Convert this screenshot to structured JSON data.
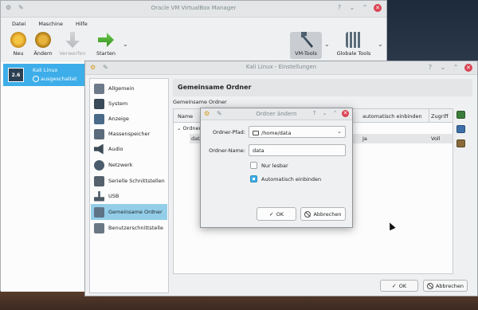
{
  "main": {
    "title": "Oracle VM VirtualBox Manager",
    "menu": [
      "Datei",
      "Maschine",
      "Hilfe"
    ],
    "toolbar": {
      "new_label": "Neu",
      "change_label": "Ändern",
      "discard_label": "Verwerfen",
      "start_label": "Starten",
      "vm_tools_label": "VM-Tools",
      "global_tools_label": "Globale Tools"
    },
    "vm": {
      "name": "Kali Linux",
      "state": "ausgeschaltet",
      "os_badge": "2.6"
    }
  },
  "settings": {
    "title": "Kali Linux - Einstellungen",
    "nav": [
      "Allgemein",
      "System",
      "Anzeige",
      "Massenspeicher",
      "Audio",
      "Netzwerk",
      "Serielle Schnittstellen",
      "USB",
      "Gemeinsame Ordner",
      "Benutzerschnittstelle"
    ],
    "selected_nav": "Gemeinsame Ordner",
    "page_title": "Gemeinsame Ordner",
    "section_label": "Gemeinsame Ordner",
    "table": {
      "columns": [
        "Name",
        "automatisch einbinden",
        "Zugriff"
      ],
      "group": "Ordner",
      "row": {
        "name": "data",
        "auto": "Ja",
        "access": "Voll"
      }
    },
    "ok_label": "OK",
    "cancel_label": "Abbrechen"
  },
  "dialog": {
    "title": "Ordner ändern",
    "path_label": "Ordner-Pfad:",
    "path_value": "/home/data",
    "name_label": "Ordner-Name:",
    "name_value": "data",
    "readonly_label": "Nur lesbar",
    "readonly_checked": false,
    "automount_label": "Automatisch einbinden",
    "automount_checked": true,
    "ok_label": "OK",
    "cancel_label": "Abbrechen"
  }
}
